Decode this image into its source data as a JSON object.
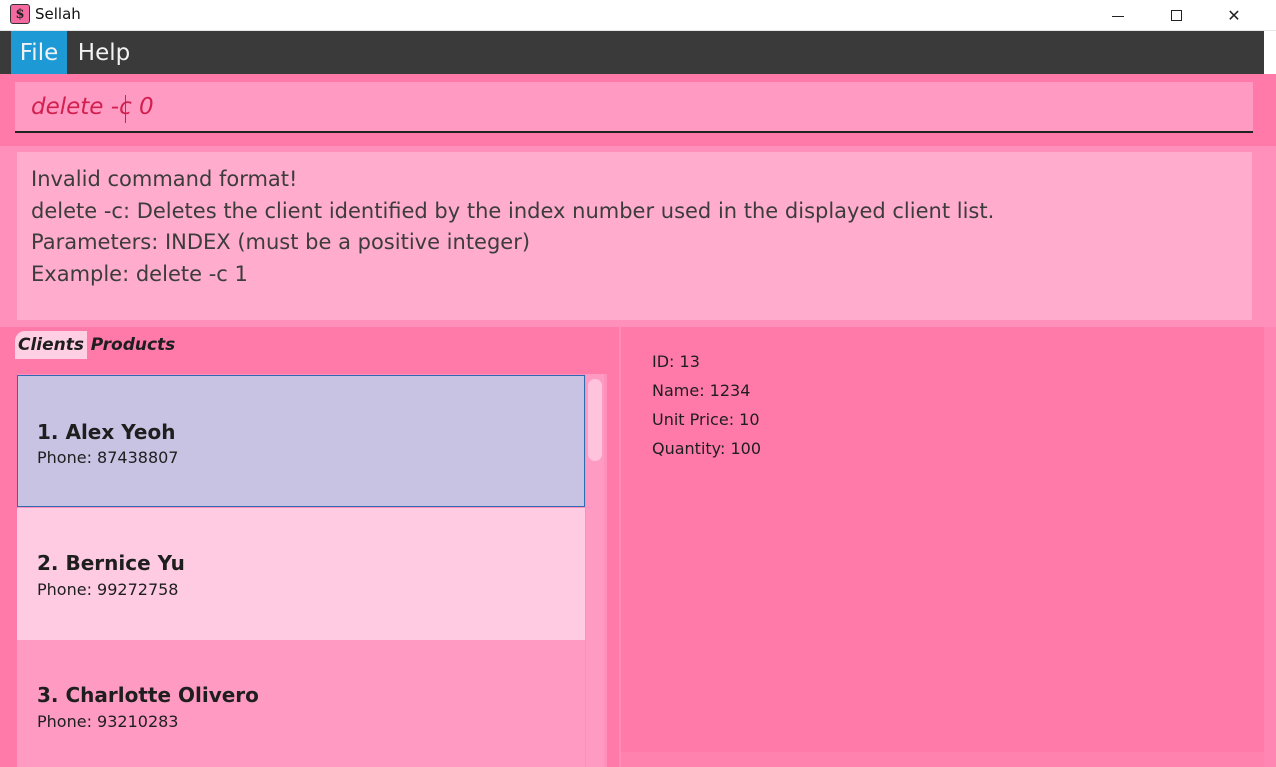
{
  "window": {
    "title": "Sellah",
    "icon": "dollar-icon",
    "app_icon_glyph": "$",
    "controls": {
      "minimize": "minimize-icon",
      "maximize": "maximize-icon",
      "close": "close-icon",
      "close_glyph": "✕"
    }
  },
  "menu": {
    "items": [
      {
        "label": "File"
      },
      {
        "label": "Help"
      }
    ]
  },
  "command": {
    "value": "delete -c 0"
  },
  "result": {
    "lines": [
      "Invalid command format!",
      "delete -c: Deletes the client identified by the index number used in the displayed client list.",
      "Parameters: INDEX (must be a positive integer)",
      "Example: delete -c 1"
    ]
  },
  "tabs": [
    {
      "label": "Clients"
    },
    {
      "label": "Products"
    }
  ],
  "clients": [
    {
      "name": "1.  Alex Yeoh",
      "phone": "Phone: 87438807"
    },
    {
      "name": "2.  Bernice Yu",
      "phone": "Phone: 99272758"
    },
    {
      "name": "3.  Charlotte Olivero",
      "phone": "Phone: 93210283"
    }
  ],
  "details": {
    "id": "ID: 13",
    "name": "Name: 1234",
    "unit_price": "Unit Price: 10",
    "quantity": "Quantity: 100"
  },
  "colors": {
    "background": "#ff7aa8",
    "menu_bar": "#3a3a3a",
    "menu_active": "#1d9ad6",
    "command_text": "#d1204f",
    "selected_item": "#c8c2e3"
  }
}
